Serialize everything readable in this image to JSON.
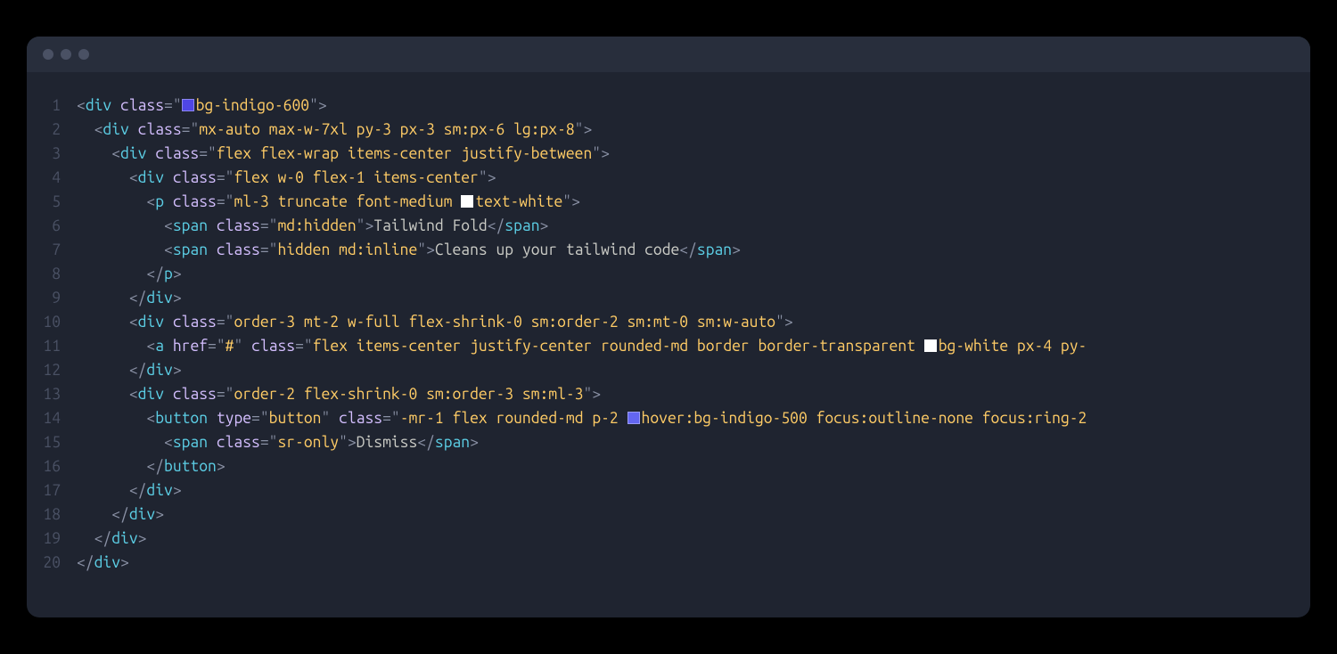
{
  "window": {
    "traffic_dots": 3
  },
  "code": {
    "lines": [
      {
        "n": "1",
        "indent": 0,
        "tokens": [
          {
            "t": "punct",
            "v": "<"
          },
          {
            "t": "tag",
            "v": "div"
          },
          {
            "t": "text",
            "v": " "
          },
          {
            "t": "attr",
            "v": "class"
          },
          {
            "t": "eq",
            "v": "="
          },
          {
            "t": "punct",
            "v": "\""
          },
          {
            "t": "swatch",
            "c": "sw-indigo600"
          },
          {
            "t": "str",
            "v": "bg-indigo-600"
          },
          {
            "t": "punct",
            "v": "\""
          },
          {
            "t": "punct",
            "v": ">"
          }
        ]
      },
      {
        "n": "2",
        "indent": 1,
        "tokens": [
          {
            "t": "punct",
            "v": "<"
          },
          {
            "t": "tag",
            "v": "div"
          },
          {
            "t": "text",
            "v": " "
          },
          {
            "t": "attr",
            "v": "class"
          },
          {
            "t": "eq",
            "v": "="
          },
          {
            "t": "punct",
            "v": "\""
          },
          {
            "t": "str",
            "v": "mx-auto max-w-7xl py-3 px-3 sm:px-6 lg:px-8"
          },
          {
            "t": "punct",
            "v": "\""
          },
          {
            "t": "punct",
            "v": ">"
          }
        ]
      },
      {
        "n": "3",
        "indent": 2,
        "tokens": [
          {
            "t": "punct",
            "v": "<"
          },
          {
            "t": "tag",
            "v": "div"
          },
          {
            "t": "text",
            "v": " "
          },
          {
            "t": "attr",
            "v": "class"
          },
          {
            "t": "eq",
            "v": "="
          },
          {
            "t": "punct",
            "v": "\""
          },
          {
            "t": "str",
            "v": "flex flex-wrap items-center justify-between"
          },
          {
            "t": "punct",
            "v": "\""
          },
          {
            "t": "punct",
            "v": ">"
          }
        ]
      },
      {
        "n": "4",
        "indent": 3,
        "tokens": [
          {
            "t": "punct",
            "v": "<"
          },
          {
            "t": "tag",
            "v": "div"
          },
          {
            "t": "text",
            "v": " "
          },
          {
            "t": "attr",
            "v": "class"
          },
          {
            "t": "eq",
            "v": "="
          },
          {
            "t": "punct",
            "v": "\""
          },
          {
            "t": "str",
            "v": "flex w-0 flex-1 items-center"
          },
          {
            "t": "punct",
            "v": "\""
          },
          {
            "t": "punct",
            "v": ">"
          }
        ]
      },
      {
        "n": "5",
        "indent": 4,
        "tokens": [
          {
            "t": "punct",
            "v": "<"
          },
          {
            "t": "tag",
            "v": "p"
          },
          {
            "t": "text",
            "v": " "
          },
          {
            "t": "attr",
            "v": "class"
          },
          {
            "t": "eq",
            "v": "="
          },
          {
            "t": "punct",
            "v": "\""
          },
          {
            "t": "str",
            "v": "ml-3 truncate font-medium "
          },
          {
            "t": "swatch",
            "c": "sw-white"
          },
          {
            "t": "str",
            "v": "text-white"
          },
          {
            "t": "punct",
            "v": "\""
          },
          {
            "t": "punct",
            "v": ">"
          }
        ]
      },
      {
        "n": "6",
        "indent": 5,
        "tokens": [
          {
            "t": "punct",
            "v": "<"
          },
          {
            "t": "tag",
            "v": "span"
          },
          {
            "t": "text",
            "v": " "
          },
          {
            "t": "attr",
            "v": "class"
          },
          {
            "t": "eq",
            "v": "="
          },
          {
            "t": "punct",
            "v": "\""
          },
          {
            "t": "str",
            "v": "md:hidden"
          },
          {
            "t": "punct",
            "v": "\""
          },
          {
            "t": "punct",
            "v": ">"
          },
          {
            "t": "text",
            "v": "Tailwind Fold"
          },
          {
            "t": "punct",
            "v": "</"
          },
          {
            "t": "tag",
            "v": "span"
          },
          {
            "t": "punct",
            "v": ">"
          }
        ]
      },
      {
        "n": "7",
        "indent": 5,
        "tokens": [
          {
            "t": "punct",
            "v": "<"
          },
          {
            "t": "tag",
            "v": "span"
          },
          {
            "t": "text",
            "v": " "
          },
          {
            "t": "attr",
            "v": "class"
          },
          {
            "t": "eq",
            "v": "="
          },
          {
            "t": "punct",
            "v": "\""
          },
          {
            "t": "str",
            "v": "hidden md:inline"
          },
          {
            "t": "punct",
            "v": "\""
          },
          {
            "t": "punct",
            "v": ">"
          },
          {
            "t": "text",
            "v": "Cleans up your tailwind code"
          },
          {
            "t": "punct",
            "v": "</"
          },
          {
            "t": "tag",
            "v": "span"
          },
          {
            "t": "punct",
            "v": ">"
          }
        ]
      },
      {
        "n": "8",
        "indent": 4,
        "tokens": [
          {
            "t": "punct",
            "v": "</"
          },
          {
            "t": "tag",
            "v": "p"
          },
          {
            "t": "punct",
            "v": ">"
          }
        ]
      },
      {
        "n": "9",
        "indent": 3,
        "tokens": [
          {
            "t": "punct",
            "v": "</"
          },
          {
            "t": "tag",
            "v": "div"
          },
          {
            "t": "punct",
            "v": ">"
          }
        ]
      },
      {
        "n": "10",
        "indent": 3,
        "tokens": [
          {
            "t": "punct",
            "v": "<"
          },
          {
            "t": "tag",
            "v": "div"
          },
          {
            "t": "text",
            "v": " "
          },
          {
            "t": "attr",
            "v": "class"
          },
          {
            "t": "eq",
            "v": "="
          },
          {
            "t": "punct",
            "v": "\""
          },
          {
            "t": "str",
            "v": "order-3 mt-2 w-full flex-shrink-0 sm:order-2 sm:mt-0 sm:w-auto"
          },
          {
            "t": "punct",
            "v": "\""
          },
          {
            "t": "punct",
            "v": ">"
          }
        ]
      },
      {
        "n": "11",
        "indent": 4,
        "tokens": [
          {
            "t": "punct",
            "v": "<"
          },
          {
            "t": "tag",
            "v": "a"
          },
          {
            "t": "text",
            "v": " "
          },
          {
            "t": "attr",
            "v": "href"
          },
          {
            "t": "eq",
            "v": "="
          },
          {
            "t": "punct",
            "v": "\""
          },
          {
            "t": "str",
            "v": "#"
          },
          {
            "t": "punct",
            "v": "\""
          },
          {
            "t": "text",
            "v": " "
          },
          {
            "t": "attr",
            "v": "class"
          },
          {
            "t": "eq",
            "v": "="
          },
          {
            "t": "punct",
            "v": "\""
          },
          {
            "t": "str",
            "v": "flex items-center justify-center rounded-md border border-transparent "
          },
          {
            "t": "swatch",
            "c": "sw-white"
          },
          {
            "t": "str",
            "v": "bg-white px-4 py-"
          }
        ]
      },
      {
        "n": "12",
        "indent": 3,
        "tokens": [
          {
            "t": "punct",
            "v": "</"
          },
          {
            "t": "tag",
            "v": "div"
          },
          {
            "t": "punct",
            "v": ">"
          }
        ]
      },
      {
        "n": "13",
        "indent": 3,
        "tokens": [
          {
            "t": "punct",
            "v": "<"
          },
          {
            "t": "tag",
            "v": "div"
          },
          {
            "t": "text",
            "v": " "
          },
          {
            "t": "attr",
            "v": "class"
          },
          {
            "t": "eq",
            "v": "="
          },
          {
            "t": "punct",
            "v": "\""
          },
          {
            "t": "str",
            "v": "order-2 flex-shrink-0 sm:order-3 sm:ml-3"
          },
          {
            "t": "punct",
            "v": "\""
          },
          {
            "t": "punct",
            "v": ">"
          }
        ]
      },
      {
        "n": "14",
        "indent": 4,
        "tokens": [
          {
            "t": "punct",
            "v": "<"
          },
          {
            "t": "tag",
            "v": "button"
          },
          {
            "t": "text",
            "v": " "
          },
          {
            "t": "attr",
            "v": "type"
          },
          {
            "t": "eq",
            "v": "="
          },
          {
            "t": "punct",
            "v": "\""
          },
          {
            "t": "str",
            "v": "button"
          },
          {
            "t": "punct",
            "v": "\""
          },
          {
            "t": "text",
            "v": " "
          },
          {
            "t": "attr",
            "v": "class"
          },
          {
            "t": "eq",
            "v": "="
          },
          {
            "t": "punct",
            "v": "\""
          },
          {
            "t": "str",
            "v": "-mr-1 flex rounded-md p-2 "
          },
          {
            "t": "swatch",
            "c": "sw-indigo500"
          },
          {
            "t": "str",
            "v": "hover:bg-indigo-500 focus:outline-none focus:ring-2"
          }
        ]
      },
      {
        "n": "15",
        "indent": 5,
        "tokens": [
          {
            "t": "punct",
            "v": "<"
          },
          {
            "t": "tag",
            "v": "span"
          },
          {
            "t": "text",
            "v": " "
          },
          {
            "t": "attr",
            "v": "class"
          },
          {
            "t": "eq",
            "v": "="
          },
          {
            "t": "punct",
            "v": "\""
          },
          {
            "t": "str",
            "v": "sr-only"
          },
          {
            "t": "punct",
            "v": "\""
          },
          {
            "t": "punct",
            "v": ">"
          },
          {
            "t": "text",
            "v": "Dismiss"
          },
          {
            "t": "punct",
            "v": "</"
          },
          {
            "t": "tag",
            "v": "span"
          },
          {
            "t": "punct",
            "v": ">"
          }
        ]
      },
      {
        "n": "16",
        "indent": 4,
        "tokens": [
          {
            "t": "punct",
            "v": "</"
          },
          {
            "t": "tag",
            "v": "button"
          },
          {
            "t": "punct",
            "v": ">"
          }
        ]
      },
      {
        "n": "17",
        "indent": 3,
        "tokens": [
          {
            "t": "punct",
            "v": "</"
          },
          {
            "t": "tag",
            "v": "div"
          },
          {
            "t": "punct",
            "v": ">"
          }
        ]
      },
      {
        "n": "18",
        "indent": 2,
        "tokens": [
          {
            "t": "punct",
            "v": "</"
          },
          {
            "t": "tag",
            "v": "div"
          },
          {
            "t": "punct",
            "v": ">"
          }
        ]
      },
      {
        "n": "19",
        "indent": 1,
        "tokens": [
          {
            "t": "punct",
            "v": "</"
          },
          {
            "t": "tag",
            "v": "div"
          },
          {
            "t": "punct",
            "v": ">"
          }
        ]
      },
      {
        "n": "20",
        "indent": 0,
        "tokens": [
          {
            "t": "punct",
            "v": "</"
          },
          {
            "t": "tag",
            "v": "div"
          },
          {
            "t": "punct",
            "v": ">"
          }
        ]
      }
    ]
  }
}
